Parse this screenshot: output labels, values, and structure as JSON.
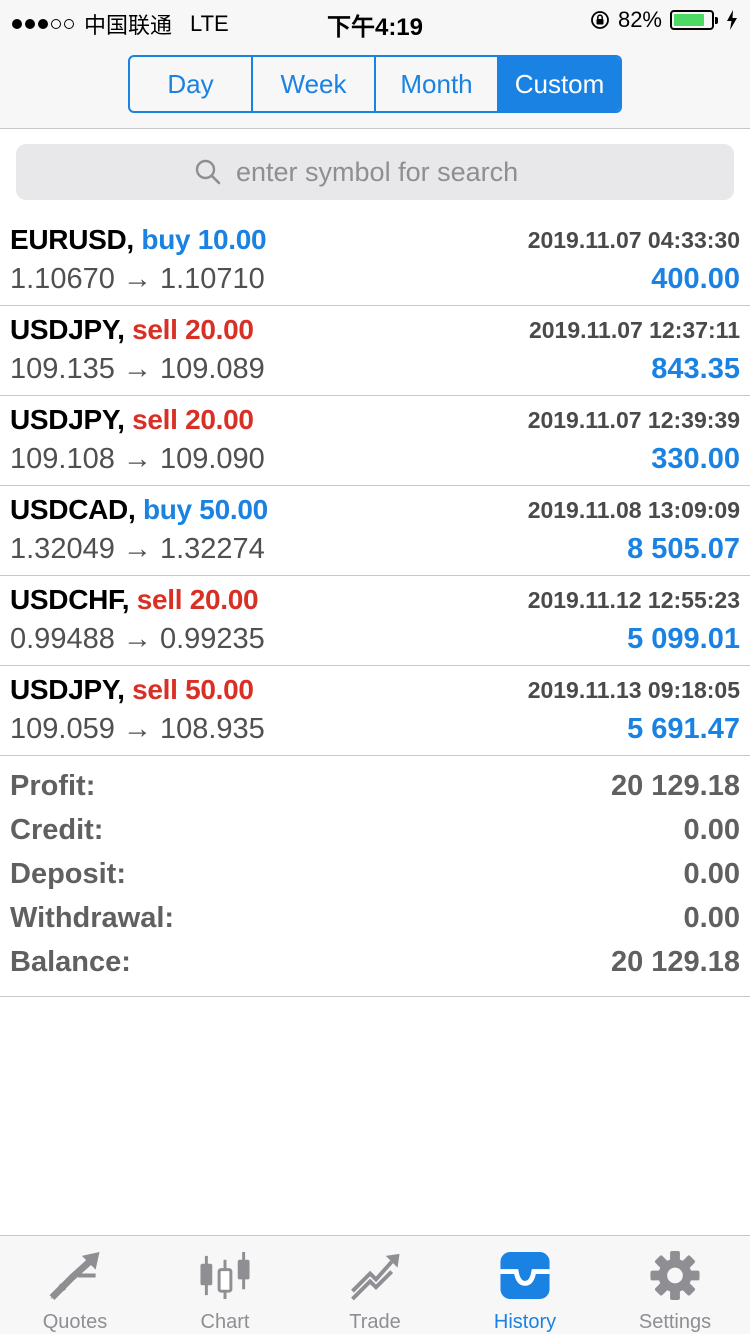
{
  "status": {
    "carrier": "中国联通",
    "network": "LTE",
    "time": "下午4:19",
    "battery_percent": "82%",
    "battery_level": 0.82
  },
  "periods": {
    "day": "Day",
    "week": "Week",
    "month": "Month",
    "custom": "Custom",
    "selected": "Custom"
  },
  "search": {
    "placeholder": "enter symbol for search"
  },
  "deals": [
    {
      "symbol": "EURUSD,",
      "side": "buy",
      "action": "buy 10.00",
      "time": "2019.11.07 04:33:30",
      "prices": "1.10670 → 1.10710",
      "profit": "400.00"
    },
    {
      "symbol": "USDJPY,",
      "side": "sell",
      "action": "sell 20.00",
      "time": "2019.11.07 12:37:11",
      "prices": "109.135 → 109.089",
      "profit": "843.35"
    },
    {
      "symbol": "USDJPY,",
      "side": "sell",
      "action": "sell 20.00",
      "time": "2019.11.07 12:39:39",
      "prices": "109.108 → 109.090",
      "profit": "330.00"
    },
    {
      "symbol": "USDCAD,",
      "side": "buy",
      "action": "buy 50.00",
      "time": "2019.11.08 13:09:09",
      "prices": "1.32049 → 1.32274",
      "profit": "8 505.07"
    },
    {
      "symbol": "USDCHF,",
      "side": "sell",
      "action": "sell 20.00",
      "time": "2019.11.12 12:55:23",
      "prices": "0.99488 → 0.99235",
      "profit": "5 099.01"
    },
    {
      "symbol": "USDJPY,",
      "side": "sell",
      "action": "sell 50.00",
      "time": "2019.11.13 09:18:05",
      "prices": "109.059 → 108.935",
      "profit": "5 691.47"
    }
  ],
  "summary": {
    "profit_label": "Profit:",
    "profit": "20 129.18",
    "credit_label": "Credit:",
    "credit": "0.00",
    "deposit_label": "Deposit:",
    "deposit": "0.00",
    "withdrawal_label": "Withdrawal:",
    "withdrawal": "0.00",
    "balance_label": "Balance:",
    "balance": "20 129.18"
  },
  "tabs": [
    {
      "label": "Quotes",
      "icon": "quotes-arrows-icon"
    },
    {
      "label": "Chart",
      "icon": "candlestick-icon"
    },
    {
      "label": "Trade",
      "icon": "trade-trend-icon"
    },
    {
      "label": "History",
      "icon": "history-tray-icon"
    },
    {
      "label": "Settings",
      "icon": "gear-icon"
    }
  ],
  "colors": {
    "accent": "#1a82e2",
    "sell": "#d93025",
    "buy": "#1a82e2"
  }
}
